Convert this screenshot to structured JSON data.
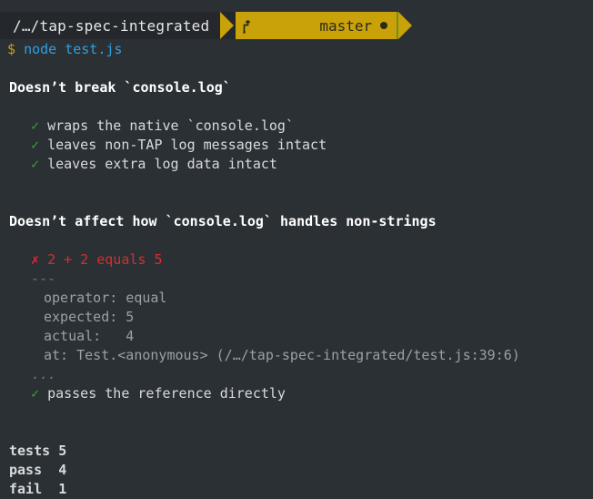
{
  "prompt": {
    "path": "/…/tap-spec-integrated",
    "git_icon": "git-branch-icon",
    "branch": "master",
    "dirty_indicator": "●",
    "sigil": "$",
    "command": "node test.js",
    "path_bg": "#24282c",
    "git_bg": "#c9a20a",
    "git_fg": "#2b2b16",
    "sigil_color": "#c9a20a",
    "command_color": "#2f9fe0"
  },
  "terminal": {
    "background": "#2b3035"
  },
  "output": {
    "suites": [
      {
        "title": "Doesn’t break `console.log`",
        "assertions": [
          {
            "symbol": "✓",
            "state": "pass",
            "text": "wraps the native `console.log`"
          },
          {
            "symbol": "✓",
            "state": "pass",
            "text": "leaves non-TAP log messages intact"
          },
          {
            "symbol": "✓",
            "state": "pass",
            "text": "leaves extra log data intact"
          }
        ]
      },
      {
        "title": "Doesn’t affect how `console.log` handles non-strings",
        "assertions": [
          {
            "symbol": "✗",
            "state": "fail",
            "text": "2 + 2 equals 5"
          }
        ],
        "diagnostic": {
          "open": "---",
          "lines": [
            "operator: equal",
            "expected: 5",
            "actual:   4",
            "at: Test.<anonymous> (/…/tap-spec-integrated/test.js:39:6)"
          ],
          "close": "..."
        },
        "assertions_after": [
          {
            "symbol": "✓",
            "state": "pass",
            "text": "passes the reference directly"
          }
        ]
      }
    ],
    "summary": [
      {
        "label": "tests",
        "value": "5"
      },
      {
        "label": "pass ",
        "value": "4"
      },
      {
        "label": "fail ",
        "value": "1"
      }
    ],
    "colors": {
      "pass": "#3d9c35",
      "fail_symbol": "#e8242a",
      "fail_text": "#d32f2f",
      "text": "#d7dbdd",
      "suite_title": "#ffffff",
      "diagnostic": "#9aa0a6",
      "diagnostic_dim": "#6e7681"
    }
  }
}
